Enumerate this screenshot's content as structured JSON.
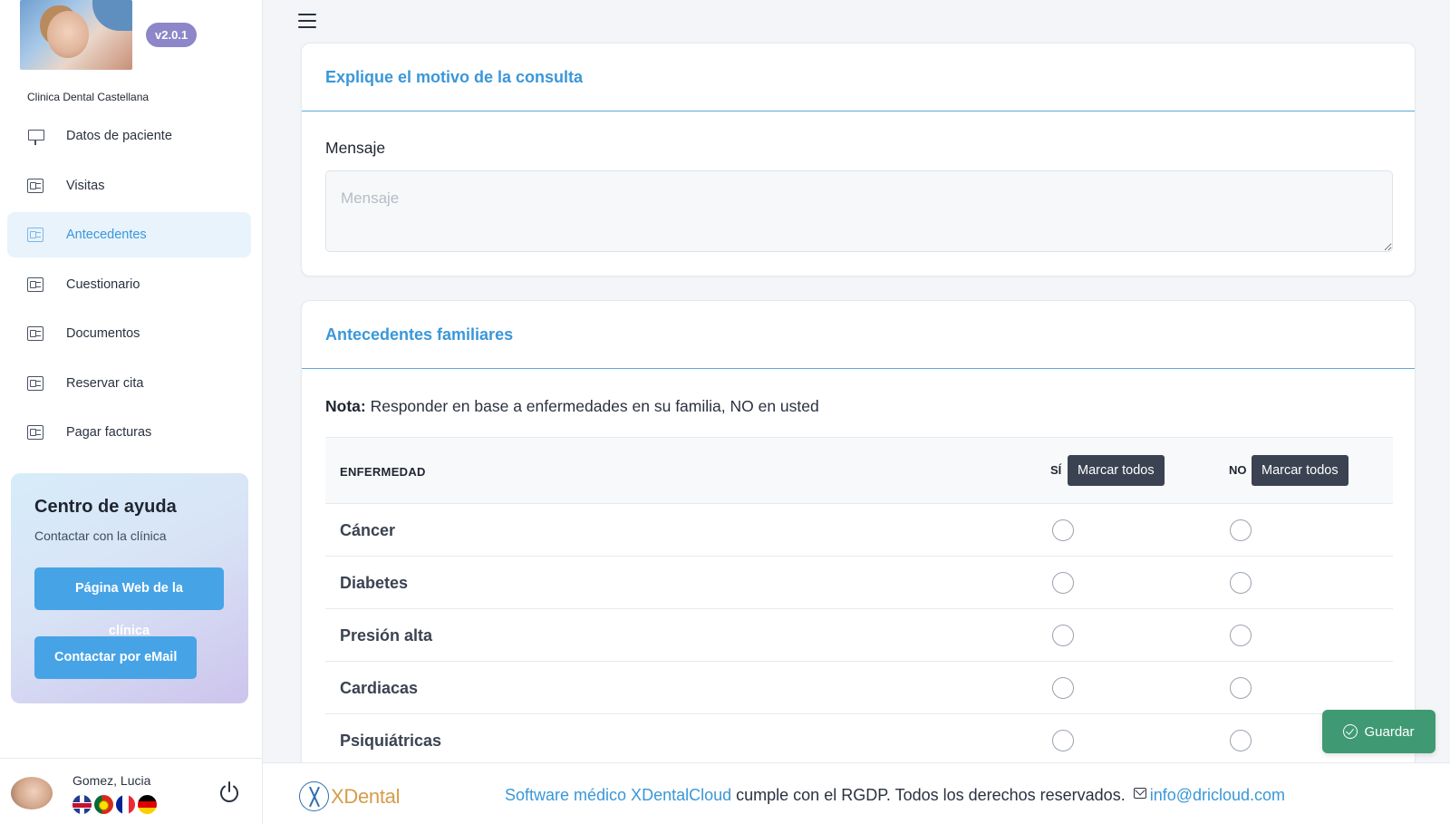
{
  "app": {
    "version": "v2.0.1",
    "clinic_name": "Clinica Dental Castellana"
  },
  "sidebar": {
    "items": [
      {
        "label": "Datos de paciente",
        "icon": "presentation-board-icon",
        "active": false
      },
      {
        "label": "Visitas",
        "icon": "id-card-icon",
        "active": false
      },
      {
        "label": "Antecedentes",
        "icon": "id-card-icon",
        "active": true
      },
      {
        "label": "Cuestionario",
        "icon": "id-card-icon",
        "active": false
      },
      {
        "label": "Documentos",
        "icon": "id-card-icon",
        "active": false
      },
      {
        "label": "Reservar cita",
        "icon": "id-card-icon",
        "active": false
      },
      {
        "label": "Pagar facturas",
        "icon": "id-card-icon",
        "active": false
      }
    ],
    "active_color": "#3a97d8"
  },
  "help": {
    "title": "Centro de ayuda",
    "subtitle": "Contactar con la clínica",
    "web_button": "Página Web de la clínica",
    "email_button": "Contactar por eMail"
  },
  "user": {
    "name": "Gomez, Lucia",
    "languages": [
      "gb-flag-icon",
      "pt-flag-icon",
      "fr-flag-icon",
      "de-flag-icon"
    ]
  },
  "consulta": {
    "title": "Explique el motivo de la consulta",
    "message_label": "Mensaje",
    "message_placeholder": "Mensaje",
    "message_value": ""
  },
  "familiares": {
    "title": "Antecedentes familiares",
    "note_bold": "Nota:",
    "note_text": " Responder en base a enfermedades en su familia, NO en usted",
    "col_disease": "ENFERMEDAD",
    "col_yes": "SÍ",
    "col_no": "NO",
    "mark_all_yes": "Marcar todos",
    "mark_all_no": "Marcar todos",
    "rows": [
      {
        "label": "Cáncer"
      },
      {
        "label": "Diabetes"
      },
      {
        "label": "Presión alta"
      },
      {
        "label": "Cardiacas"
      },
      {
        "label": "Psiquiátricas"
      }
    ]
  },
  "actions": {
    "save_label": "Guardar",
    "save_color": "#3f9a73"
  },
  "footer": {
    "logo_text": "XDental",
    "link_text": "Software médico XDentalCloud",
    "text": " cumple con el RGDP. Todos los derechos reservados.",
    "email": "info@dricloud.com"
  }
}
